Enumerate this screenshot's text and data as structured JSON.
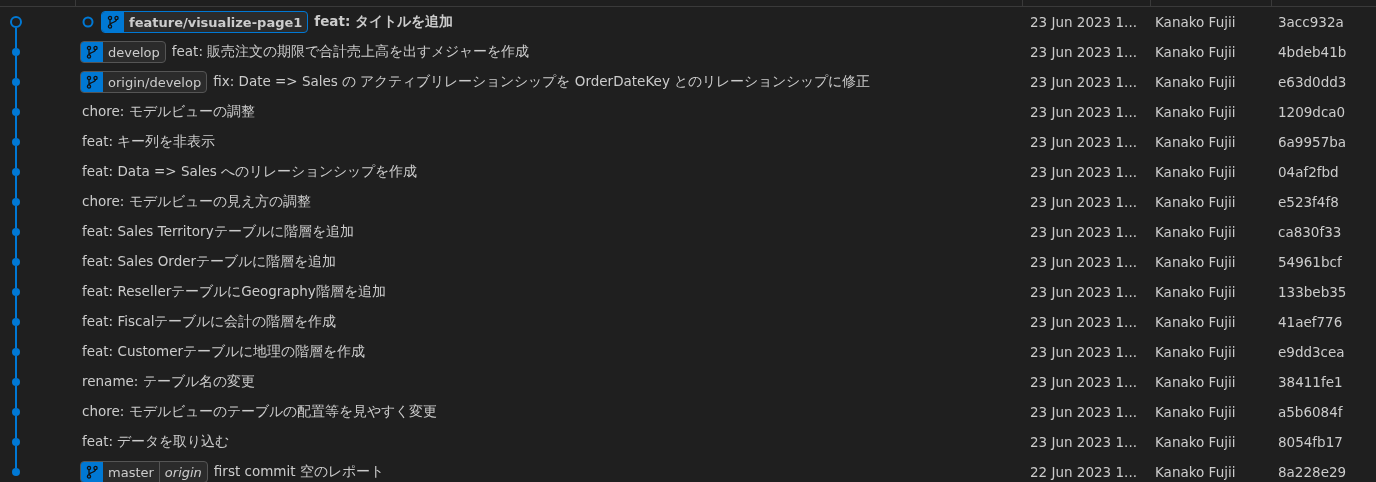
{
  "commits": [
    {
      "message": "feat: タイトルを追加",
      "head": true,
      "refs": [
        {
          "label": "feature/visualize-page1",
          "current": true
        }
      ],
      "date": "23 Jun 2023 1...",
      "author": "Kanako Fujii",
      "hash": "3acc932a"
    },
    {
      "message": "feat: 販売注文の期限で合計売上高を出すメジャーを作成",
      "head": false,
      "refs": [
        {
          "label": "develop",
          "current": false
        }
      ],
      "date": "23 Jun 2023 1...",
      "author": "Kanako Fujii",
      "hash": "4bdeb41b"
    },
    {
      "message": "fix: Date => Sales の アクティブリレーションシップを OrderDateKey とのリレーションシップに修正",
      "head": false,
      "refs": [
        {
          "label": "origin/develop",
          "current": false
        }
      ],
      "date": "23 Jun 2023 1...",
      "author": "Kanako Fujii",
      "hash": "e63d0dd3"
    },
    {
      "message": "chore: モデルビューの調整",
      "head": false,
      "date": "23 Jun 2023 1...",
      "author": "Kanako Fujii",
      "hash": "1209dca0"
    },
    {
      "message": "feat: キー列を非表示",
      "head": false,
      "date": "23 Jun 2023 1...",
      "author": "Kanako Fujii",
      "hash": "6a9957ba"
    },
    {
      "message": "feat: Data => Sales へのリレーションシップを作成",
      "head": false,
      "date": "23 Jun 2023 1...",
      "author": "Kanako Fujii",
      "hash": "04af2fbd"
    },
    {
      "message": "chore: モデルビューの見え方の調整",
      "head": false,
      "date": "23 Jun 2023 1...",
      "author": "Kanako Fujii",
      "hash": "e523f4f8"
    },
    {
      "message": "feat: Sales Territoryテーブルに階層を追加",
      "head": false,
      "date": "23 Jun 2023 1...",
      "author": "Kanako Fujii",
      "hash": "ca830f33"
    },
    {
      "message": "feat: Sales Orderテーブルに階層を追加",
      "head": false,
      "date": "23 Jun 2023 1...",
      "author": "Kanako Fujii",
      "hash": "54961bcf"
    },
    {
      "message": "feat: ResellerテーブルにGeography階層を追加",
      "head": false,
      "date": "23 Jun 2023 1...",
      "author": "Kanako Fujii",
      "hash": "133beb35"
    },
    {
      "message": "feat: Fiscalテーブルに会計の階層を作成",
      "head": false,
      "date": "23 Jun 2023 1...",
      "author": "Kanako Fujii",
      "hash": "41aef776"
    },
    {
      "message": "feat: Customerテーブルに地理の階層を作成",
      "head": false,
      "date": "23 Jun 2023 1...",
      "author": "Kanako Fujii",
      "hash": "e9dd3cea"
    },
    {
      "message": "rename: テーブル名の変更",
      "head": false,
      "date": "23 Jun 2023 1...",
      "author": "Kanako Fujii",
      "hash": "38411fe1"
    },
    {
      "message": "chore: モデルビューのテーブルの配置等を見やすく変更",
      "head": false,
      "date": "23 Jun 2023 1...",
      "author": "Kanako Fujii",
      "hash": "a5b6084f"
    },
    {
      "message": "feat: データを取り込む",
      "head": false,
      "date": "23 Jun 2023 1...",
      "author": "Kanako Fujii",
      "hash": "8054fb17"
    },
    {
      "message": "first commit 空のレポート",
      "head": false,
      "refs": [
        {
          "label": "master",
          "current": false,
          "remotes": [
            "origin"
          ]
        }
      ],
      "date": "22 Jun 2023 1...",
      "author": "Kanako Fujii",
      "hash": "8a228e29"
    }
  ]
}
